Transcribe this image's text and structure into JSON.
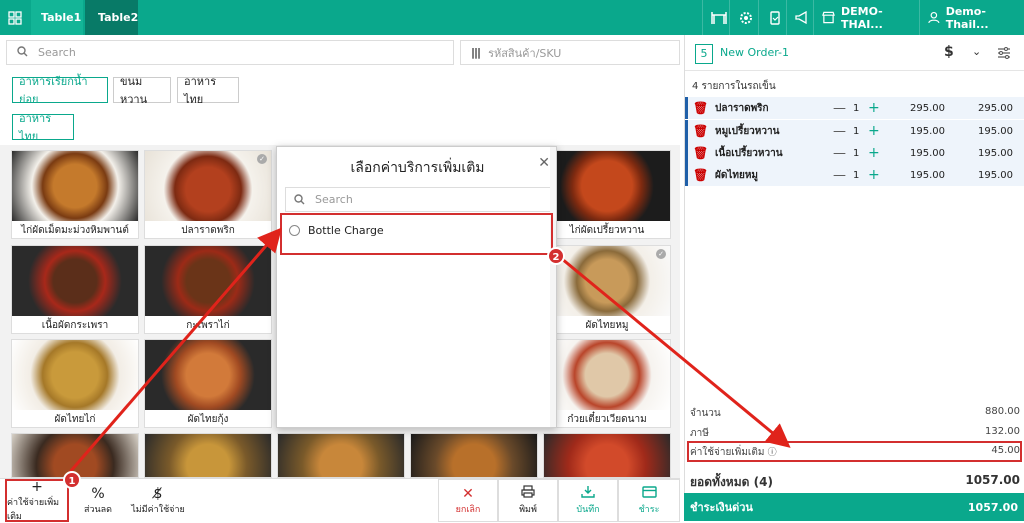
{
  "topbar": {
    "tabs": [
      "Table1",
      "Table2"
    ],
    "store": "DEMO-THAI...",
    "user": "Demo- Thail..."
  },
  "search": {
    "placeholder": "Search",
    "sku_placeholder": "รหัสสินค้า/SKU"
  },
  "categories": [
    "อาหารเรียกน้ำย่อย",
    "ขนมหวาน",
    "อาหารไทย",
    "อาหารไทย"
  ],
  "products": [
    "ไก่ผัดเม็ดมะม่วงหิมพานต์",
    "ปลาราดพริก",
    "ไก่ผัดเปรี้ยวหวาน",
    "เนื้อผัดกระเพรา",
    "กะเพราไก่",
    "ผัดไทยหมู",
    "ผัดไทยไก่",
    "ผัดไทยกุ้ง",
    "ก๋วยเตี๋ยวเวียดนาม"
  ],
  "bottom": {
    "extra_charge": "ค่าใช้จ่ายเพิ่มเติม",
    "discount": "ส่วนลด",
    "no_charge": "ไม่มีค่าใช้จ่าย",
    "cancel": "ยกเลิก",
    "print": "พิมพ์",
    "save": "บันทึก",
    "pay": "ชำระ"
  },
  "modal": {
    "title": "เลือกค่าบริการเพิ่มเติม",
    "search_placeholder": "Search",
    "option": "Bottle Charge"
  },
  "order": {
    "number": "5",
    "name": "New Order-1",
    "currency": "$",
    "count_text": "4 รายการในรถเข็น",
    "items": [
      {
        "name": "ปลาราดพริก",
        "qty": "1",
        "price": "295.00",
        "total": "295.00"
      },
      {
        "name": "หมูเปรี้ยวหวาน",
        "qty": "1",
        "price": "195.00",
        "total": "195.00"
      },
      {
        "name": "เนื้อเปรี้ยวหวาน",
        "qty": "1",
        "price": "195.00",
        "total": "195.00"
      },
      {
        "name": "ผัดไทยหมู",
        "qty": "1",
        "price": "195.00",
        "total": "195.00"
      }
    ],
    "subtotal_label": "จำนวน",
    "subtotal": "880.00",
    "tax_label": "ภาษี",
    "tax": "132.00",
    "extra_label": "ค่าใช้จ่ายเพิ่มเติม",
    "extra": "45.00",
    "grand_label": "ยอดทั้งหมด",
    "grand_count": "(4)",
    "grand": "1057.00",
    "quickpay_label": "ชำระเงินด่วน",
    "quickpay": "1057.00"
  },
  "annotations": [
    "1",
    "2"
  ],
  "colors": {
    "accent": "#0aa88c",
    "highlight": "#d32f2f"
  }
}
